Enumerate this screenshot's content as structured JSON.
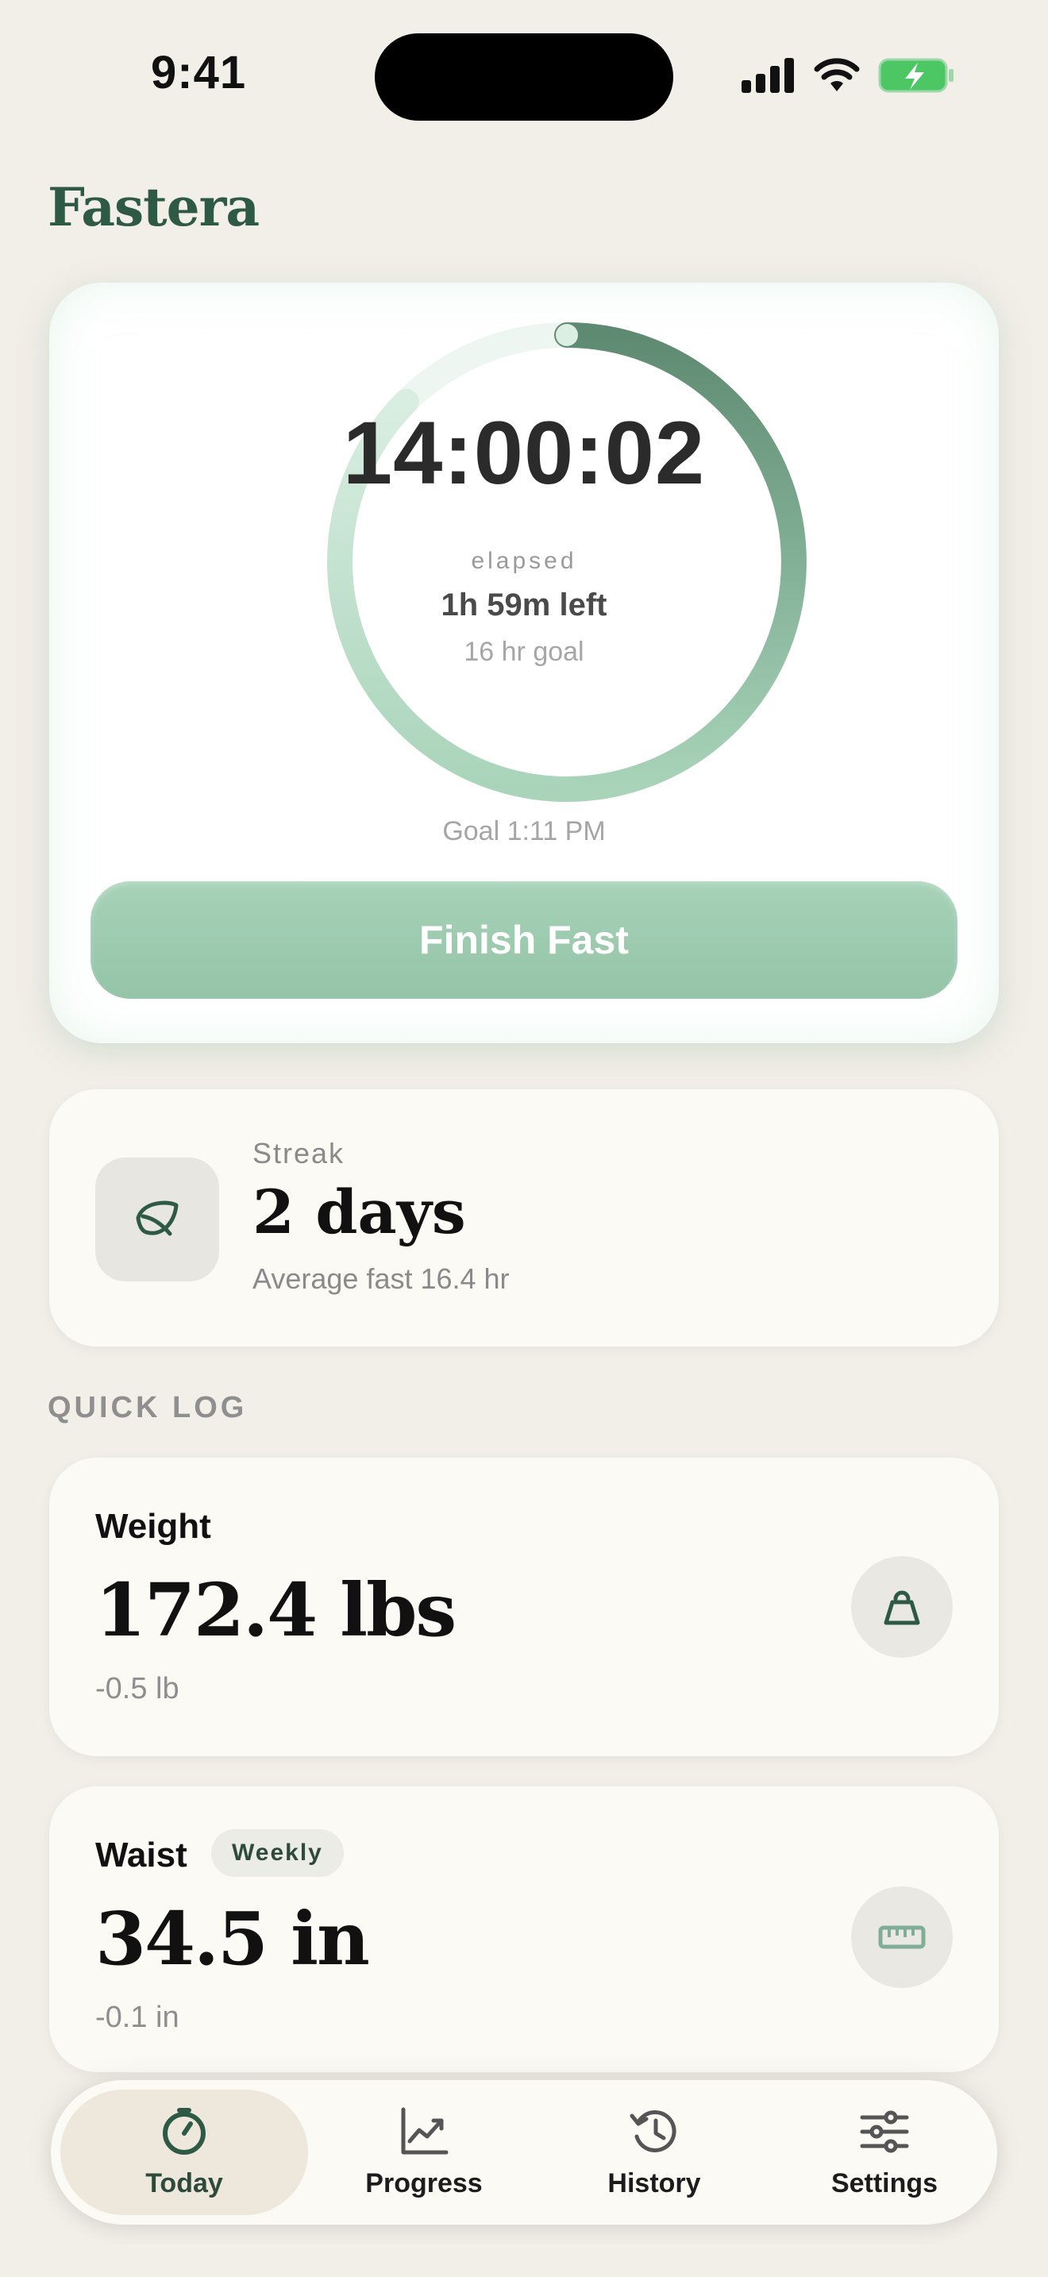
{
  "status": {
    "time": "9:41"
  },
  "app": {
    "title": "Fastera",
    "accent": "#2E5A45",
    "button_color": "#9CCBB0"
  },
  "timer": {
    "elapsed_time": "14:00:02",
    "elapsed_label": "elapsed",
    "time_left": "1h 59m left",
    "goal_hours_label": "16 hr goal",
    "goal_time": "Goal 1:11 PM",
    "progress": 0.875,
    "finish_button": "Finish Fast"
  },
  "streak": {
    "label": "Streak",
    "value": "2 days",
    "subtitle": "Average fast 16.4 hr",
    "icon": "leaf-icon"
  },
  "quick_log": {
    "title": "QUICK LOG",
    "weight": {
      "label": "Weight",
      "value": "172.4 lbs",
      "delta": "-0.5 lb",
      "icon": "kettlebell-icon"
    },
    "waist": {
      "label": "Waist",
      "badge": "Weekly",
      "value": "34.5 in",
      "delta": "-0.1 in",
      "icon": "tape-measure-icon"
    }
  },
  "tabs": [
    {
      "label": "Today",
      "icon": "timer-icon",
      "active": true
    },
    {
      "label": "Progress",
      "icon": "chart-icon",
      "active": false
    },
    {
      "label": "History",
      "icon": "history-icon",
      "active": false
    },
    {
      "label": "Settings",
      "icon": "sliders-icon",
      "active": false
    }
  ]
}
